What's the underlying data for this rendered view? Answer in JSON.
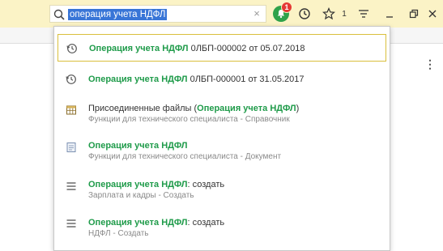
{
  "search": {
    "query": "операция учета НДФЛ",
    "clear": "×"
  },
  "toolbar": {
    "notifications_count": "1",
    "favorites_count": "1"
  },
  "more_menu": "⋮",
  "results": [
    {
      "icon": "history-icon",
      "highlight": "Операция учета НДФЛ",
      "prefix": "",
      "suffix": " 0ЛБП-000002 от 05.07.2018",
      "sub": ""
    },
    {
      "icon": "history-icon",
      "highlight": "Операция учета НДФЛ",
      "prefix": "",
      "suffix": " 0ЛБП-000001 от 31.05.2017",
      "sub": ""
    },
    {
      "icon": "table-icon",
      "prefix": "Присоединенные файлы (",
      "highlight": "Операция учета НДФЛ",
      "suffix": ")",
      "sub": "Функции для технического специалиста - Справочник"
    },
    {
      "icon": "document-icon",
      "prefix": "",
      "highlight": "Операция учета НДФЛ",
      "suffix": "",
      "sub": "Функции для технического специалиста - Документ"
    },
    {
      "icon": "list-icon",
      "prefix": "",
      "highlight": "Операция учета НДФЛ",
      "suffix": ": создать",
      "sub": "Зарплата и кадры - Создать"
    },
    {
      "icon": "list-icon",
      "prefix": "",
      "highlight": "Операция учета НДФЛ",
      "suffix": ": создать",
      "sub": "НДФЛ - Создать"
    }
  ],
  "colors": {
    "topbar": "#fbf3c6",
    "highlight": "#1f9b4a",
    "selection": "#3875d7",
    "active_border": "#d9bf3c"
  }
}
